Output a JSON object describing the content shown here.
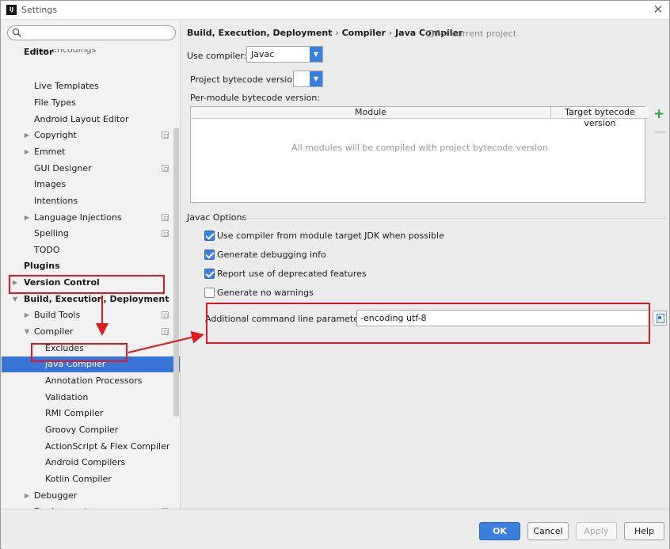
{
  "window": {
    "title": "Settings",
    "app_icon_text": "IJ",
    "close_glyph": "✕"
  },
  "search": {
    "placeholder": "",
    "icon": "search-icon"
  },
  "sidebar": {
    "items": [
      {
        "label": "File Encodings",
        "indent": 2,
        "arrow": "",
        "copy": true,
        "bold": false
      },
      {
        "label": "Editor",
        "indent": 1,
        "arrow": "",
        "copy": false,
        "bold": true
      },
      {
        "label": "Live Templates",
        "indent": 2,
        "arrow": "",
        "copy": false,
        "bold": false
      },
      {
        "label": "File Types",
        "indent": 2,
        "arrow": "",
        "copy": false,
        "bold": false
      },
      {
        "label": "Android Layout Editor",
        "indent": 2,
        "arrow": "",
        "copy": false,
        "bold": false
      },
      {
        "label": "Copyright",
        "indent": 2,
        "arrow": "▶",
        "copy": true,
        "bold": false
      },
      {
        "label": "Emmet",
        "indent": 2,
        "arrow": "▶",
        "copy": false,
        "bold": false
      },
      {
        "label": "GUI Designer",
        "indent": 2,
        "arrow": "",
        "copy": true,
        "bold": false
      },
      {
        "label": "Images",
        "indent": 2,
        "arrow": "",
        "copy": false,
        "bold": false
      },
      {
        "label": "Intentions",
        "indent": 2,
        "arrow": "",
        "copy": false,
        "bold": false
      },
      {
        "label": "Language Injections",
        "indent": 2,
        "arrow": "▶",
        "copy": true,
        "bold": false
      },
      {
        "label": "Spelling",
        "indent": 2,
        "arrow": "",
        "copy": true,
        "bold": false
      },
      {
        "label": "TODO",
        "indent": 2,
        "arrow": "",
        "copy": false,
        "bold": false
      },
      {
        "label": "Plugins",
        "indent": 1,
        "arrow": "",
        "copy": false,
        "bold": true
      },
      {
        "label": "Version Control",
        "indent": 1,
        "arrow": "▶",
        "copy": false,
        "bold": true
      },
      {
        "label": "Build, Execution, Deployment",
        "indent": 1,
        "arrow": "▼",
        "copy": false,
        "bold": true
      },
      {
        "label": "Build Tools",
        "indent": 2,
        "arrow": "▶",
        "copy": true,
        "bold": false
      },
      {
        "label": "Compiler",
        "indent": 2,
        "arrow": "▼",
        "copy": true,
        "bold": false
      },
      {
        "label": "Excludes",
        "indent": 3,
        "arrow": "",
        "copy": false,
        "bold": false
      },
      {
        "label": "Java Compiler",
        "indent": 3,
        "arrow": "",
        "copy": false,
        "bold": false,
        "selected": true
      },
      {
        "label": "Annotation Processors",
        "indent": 3,
        "arrow": "",
        "copy": false,
        "bold": false
      },
      {
        "label": "Validation",
        "indent": 3,
        "arrow": "",
        "copy": false,
        "bold": false
      },
      {
        "label": "RMI Compiler",
        "indent": 3,
        "arrow": "",
        "copy": false,
        "bold": false
      },
      {
        "label": "Groovy Compiler",
        "indent": 3,
        "arrow": "",
        "copy": false,
        "bold": false
      },
      {
        "label": "ActionScript & Flex Compiler",
        "indent": 3,
        "arrow": "",
        "copy": false,
        "bold": false
      },
      {
        "label": "Android Compilers",
        "indent": 3,
        "arrow": "",
        "copy": false,
        "bold": false
      },
      {
        "label": "Kotlin Compiler",
        "indent": 3,
        "arrow": "",
        "copy": false,
        "bold": false
      },
      {
        "label": "Debugger",
        "indent": 2,
        "arrow": "▶",
        "copy": false,
        "bold": false
      },
      {
        "label": "Deployment",
        "indent": 2,
        "arrow": "▶",
        "copy": true,
        "bold": false
      }
    ]
  },
  "main": {
    "breadcrumb": [
      "Build, Execution, Deployment",
      "Compiler",
      "Java Compiler"
    ],
    "breadcrumb_sep": "›",
    "project_note": "For current project",
    "use_compiler_label": "Use compiler:",
    "use_compiler_value": "Javac",
    "bytecode_label": "Project bytecode version:",
    "bytecode_value": "",
    "per_module_label": "Per-module bytecode version:",
    "table": {
      "headers": [
        "Module",
        "Target bytecode version"
      ],
      "empty_text": "All modules will be compiled with project bytecode version"
    },
    "add_glyph": "+",
    "remove_glyph": "—",
    "javac_section": "Javac Options",
    "options": [
      {
        "label": "Use compiler from module target JDK when possible",
        "checked": true
      },
      {
        "label": "Generate debugging info",
        "checked": true
      },
      {
        "label": "Report use of deprecated features",
        "checked": true
      },
      {
        "label": "Generate no warnings",
        "checked": false
      }
    ],
    "params_label": "Additional command line parameters:",
    "params_value": "-encoding utf-8"
  },
  "footer": {
    "ok": "OK",
    "cancel": "Cancel",
    "apply": "Apply",
    "help": "Help"
  },
  "colors": {
    "accent": "#3a80e0",
    "selection": "#3875d7",
    "annotation_red": "#e0181f"
  }
}
